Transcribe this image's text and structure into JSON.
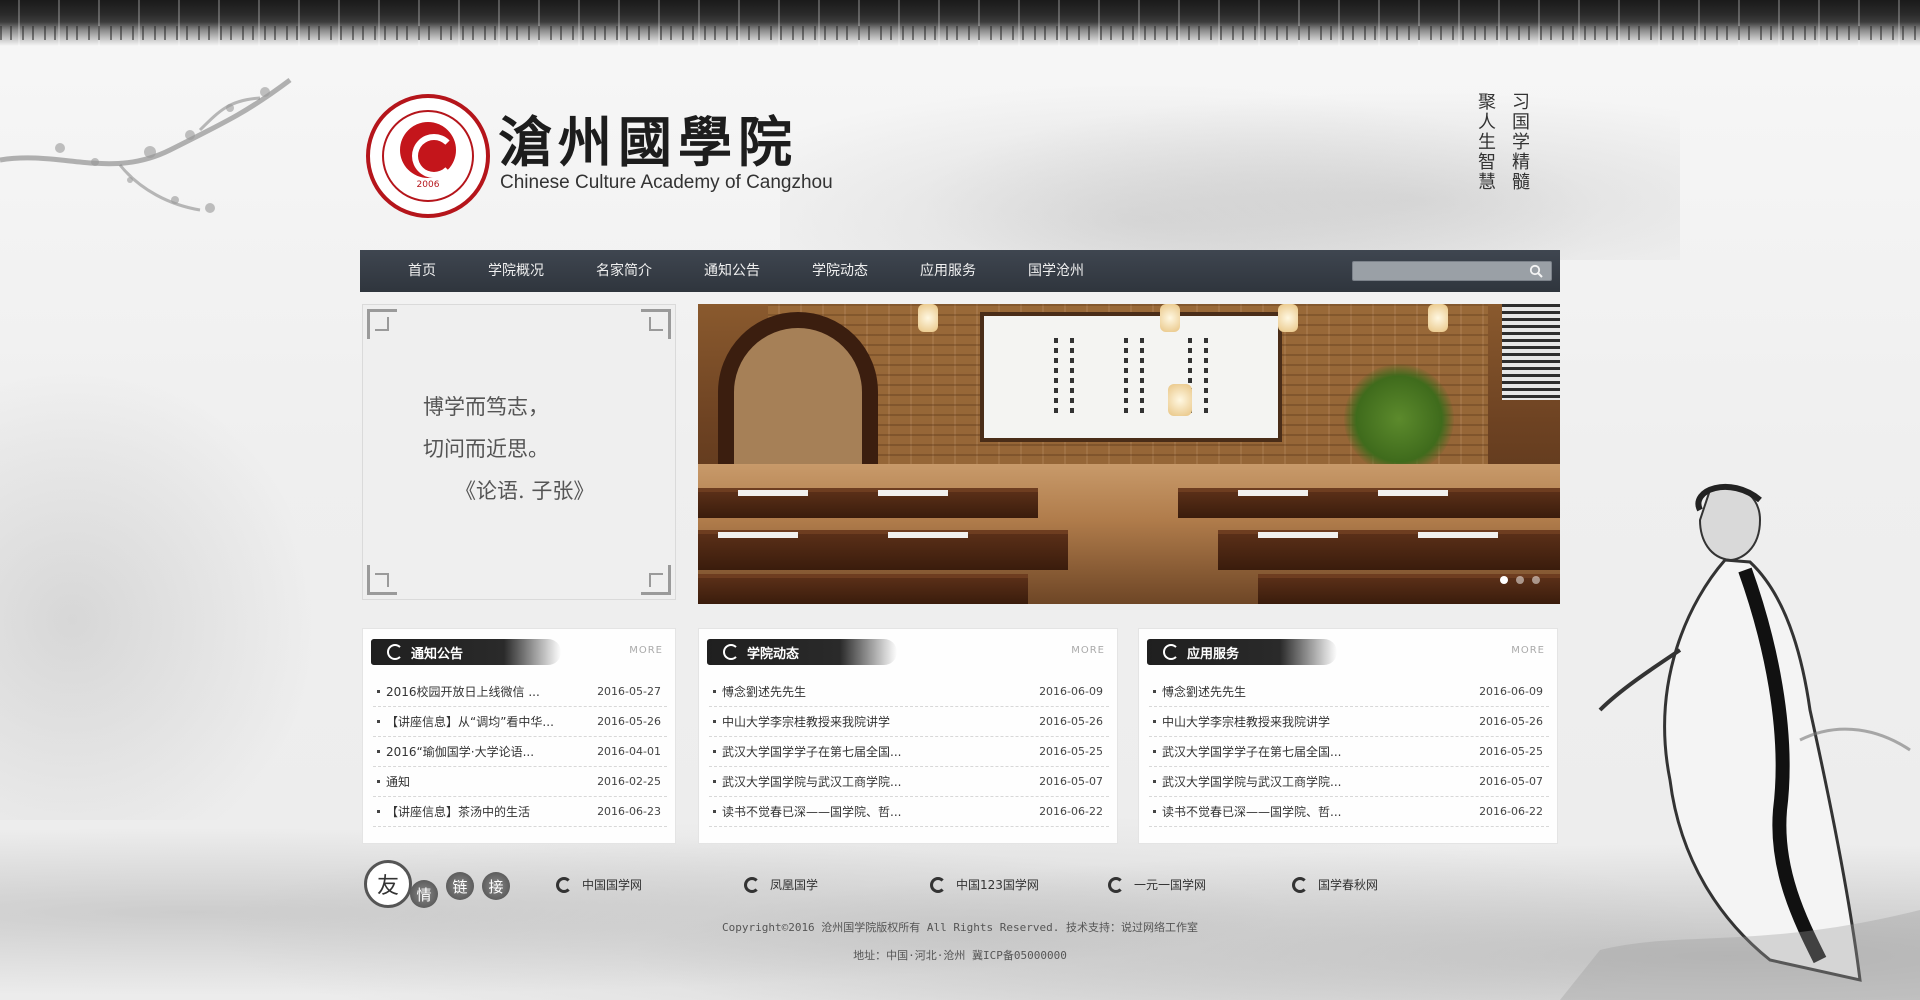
{
  "site": {
    "title_cn": "滄州國學院",
    "title_en": "Chinese Culture Academy of Cangzhou",
    "seal_year": "2006",
    "motto": [
      "习国学精髓",
      "聚人生智慧"
    ]
  },
  "nav": {
    "items": [
      {
        "label": "首页"
      },
      {
        "label": "学院概况"
      },
      {
        "label": "名家简介"
      },
      {
        "label": "通知公告"
      },
      {
        "label": "学院动态"
      },
      {
        "label": "应用服务"
      },
      {
        "label": "国学沧州"
      }
    ],
    "search_placeholder": "",
    "search_icon": "search-icon"
  },
  "quote": {
    "line1": "博学而笃志，",
    "line2": "切问而近思。",
    "source": "《论语. 子张》"
  },
  "slider": {
    "dots": 3,
    "active_index": 0
  },
  "panels": [
    {
      "title": "通知公告",
      "more": "MORE",
      "items": [
        {
          "title": "2016校园开放日上线微信 ...",
          "date": "2016-05-27"
        },
        {
          "title": "【讲座信息】从“调均”看中华...",
          "date": "2016-05-26"
        },
        {
          "title": "2016“瑜伽国学·大学论语...",
          "date": "2016-04-01"
        },
        {
          "title": "通知",
          "date": "2016-02-25"
        },
        {
          "title": "【讲座信息】茶汤中的生活",
          "date": "2016-06-23"
        }
      ]
    },
    {
      "title": "学院动态",
      "more": "MORE",
      "items": [
        {
          "title": "愽念劉述先先生",
          "date": "2016-06-09"
        },
        {
          "title": "中山大学李宗桂教授来我院讲学",
          "date": "2016-05-26"
        },
        {
          "title": "武汉大学国学学子在第七届全国...",
          "date": "2016-05-25"
        },
        {
          "title": "武汉大学国学院与武汉工商学院...",
          "date": "2016-05-07"
        },
        {
          "title": "读书不觉春已深——国学院、哲...",
          "date": "2016-06-22"
        }
      ]
    },
    {
      "title": "应用服务",
      "more": "MORE",
      "items": [
        {
          "title": "愽念劉述先先生",
          "date": "2016-06-09"
        },
        {
          "title": "中山大学李宗桂教授来我院讲学",
          "date": "2016-05-26"
        },
        {
          "title": "武汉大学国学学子在第七届全国...",
          "date": "2016-05-25"
        },
        {
          "title": "武汉大学国学院与武汉工商学院...",
          "date": "2016-05-07"
        },
        {
          "title": "读书不觉春已深——国学院、哲...",
          "date": "2016-06-22"
        }
      ]
    }
  ],
  "friends": {
    "label_chars": [
      "友",
      "情",
      "链",
      "接"
    ],
    "links": [
      "中国国学网",
      "凤凰国学",
      "中国123国学网",
      "一元一国学网",
      "国学春秋网"
    ]
  },
  "footer": {
    "copyright": "Copyright©2016 沧州国学院版权所有 All Rights Reserved.  技术支持：说过网络工作室",
    "address": "地址：中国·河北·沧州  冀ICP备05000000"
  }
}
